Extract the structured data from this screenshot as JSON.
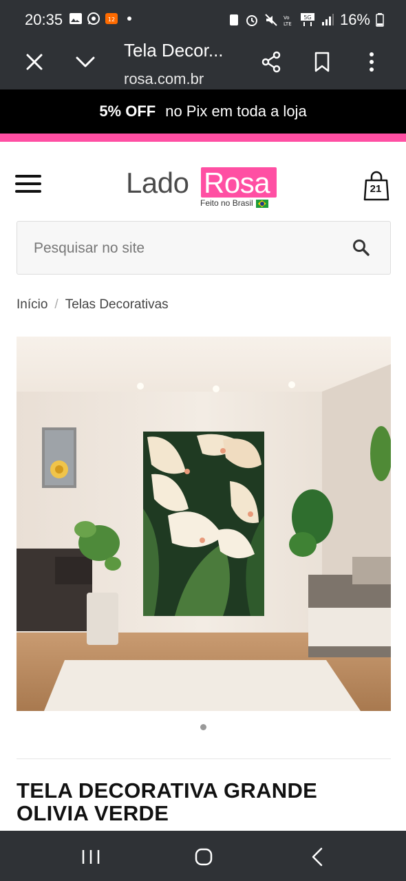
{
  "status": {
    "time": "20:35",
    "battery": "16%",
    "network": "5G"
  },
  "browser": {
    "title": "Tela Decor...",
    "url": "rosa.com.br"
  },
  "promo": {
    "bold": "5% OFF",
    "text": "no Pix em toda a loja"
  },
  "brand": {
    "lado": "Lado",
    "rosa": "Rosa",
    "tagline": "Feito no Brasil",
    "accent": "#ff4fa3"
  },
  "cart": {
    "count": "21"
  },
  "search": {
    "placeholder": "Pesquisar no site",
    "value": ""
  },
  "breadcrumb": {
    "home": "Início",
    "separator": "/",
    "current": "Telas Decorativas"
  },
  "product": {
    "title": "TELA DECORATIVA GRANDE OLIVIA VERDE"
  }
}
